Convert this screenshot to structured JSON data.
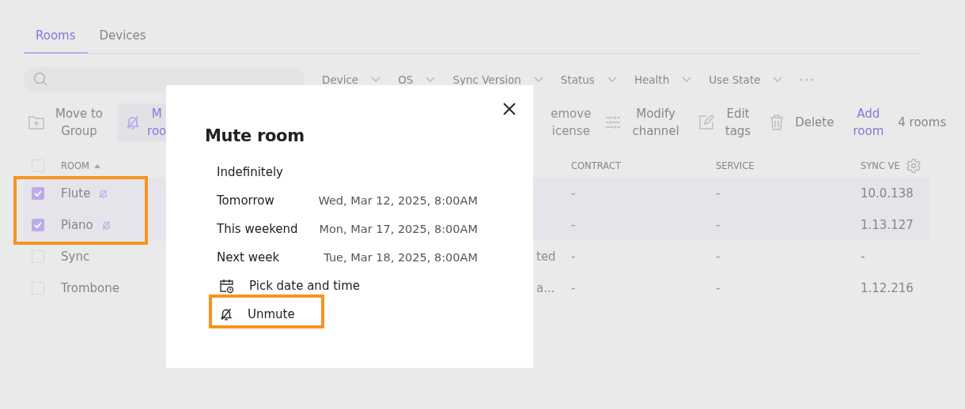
{
  "tabs": [
    {
      "label": "Rooms",
      "selected": true
    },
    {
      "label": "Devices",
      "selected": false
    }
  ],
  "filters": [
    "Device",
    "OS",
    "Sync Version",
    "Status",
    "Health",
    "Use State"
  ],
  "toolbar": [
    {
      "kind": "folder",
      "lines": [
        "Move to",
        "Group"
      ]
    },
    {
      "kind": "bell",
      "lines": [
        "M",
        "roo"
      ],
      "highlighted": true
    },
    {
      "kind": "partial",
      "lines": [
        "emove",
        "icense"
      ]
    },
    {
      "kind": "sliders",
      "lines": [
        "Modify",
        "channel"
      ]
    },
    {
      "kind": "pencil",
      "lines": [
        "Edit",
        "tags"
      ]
    },
    {
      "kind": "trash",
      "lines": [
        "Delete"
      ]
    },
    {
      "kind": "link",
      "lines": [
        "Add",
        "room"
      ]
    }
  ],
  "room_count": "4 rooms",
  "table": {
    "select_all": {
      "checked": false
    },
    "columns": [
      {
        "label": "ROOM",
        "sorted": true
      },
      {
        "label": "CONTRACT",
        "sorted": false
      },
      {
        "label": "SERVICE",
        "sorted": false
      },
      {
        "label": "SYNC VE",
        "sorted": false
      }
    ],
    "rows": [
      {
        "selected": true,
        "room": "Flute",
        "muted": true,
        "contract": "-",
        "service": "-",
        "sync_version": "10.0.138"
      },
      {
        "selected": true,
        "room": "Piano",
        "muted": true,
        "contract": "-",
        "service": "-",
        "sync_version": "1.13.127"
      },
      {
        "selected": false,
        "room": "Sync",
        "muted": false,
        "column_3": "ted",
        "contract": "-",
        "service": "-",
        "sync_version": "-"
      },
      {
        "selected": false,
        "room": "Trombone",
        "muted": false,
        "column_3": "a...",
        "contract": "-",
        "service": "-",
        "sync_version": "1.12.216"
      }
    ]
  },
  "modal": {
    "title": "Mute room",
    "options": [
      {
        "kind": "preset",
        "label": "Indefinitely"
      },
      {
        "kind": "preset",
        "label": "Tomorrow",
        "date": "Wed, Mar 12, 2025, 8:00AM"
      },
      {
        "kind": "preset",
        "label": "This weekend",
        "date": "Mon, Mar 17, 2025, 8:00AM"
      },
      {
        "kind": "preset",
        "label": "Next week",
        "date": "Tue, Mar 18, 2025, 8:00AM"
      },
      {
        "kind": "picker",
        "label": "Pick date and time"
      },
      {
        "kind": "unmute",
        "label": "Unmute"
      }
    ]
  }
}
